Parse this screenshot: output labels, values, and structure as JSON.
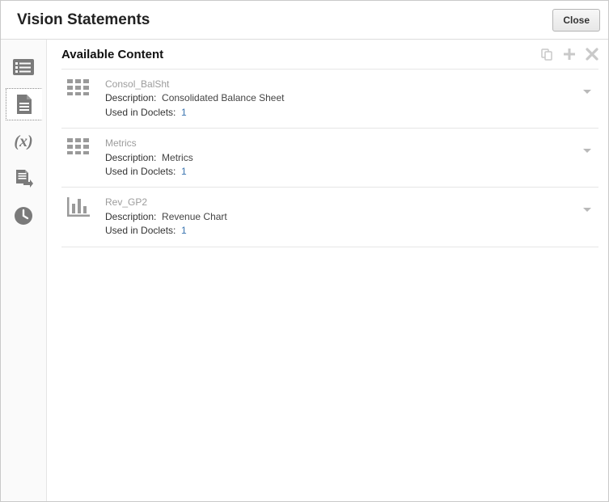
{
  "window": {
    "title": "Vision Statements",
    "close_label": "Close"
  },
  "main": {
    "heading": "Available Content",
    "labels": {
      "description": "Description:",
      "used_in_doclets": "Used in Doclets:"
    },
    "items": [
      {
        "name": "Consol_BalSht",
        "description": "Consolidated Balance Sheet",
        "used_count": "1",
        "icon": "grid"
      },
      {
        "name": "Metrics",
        "description": "Metrics",
        "used_count": "1",
        "icon": "grid"
      },
      {
        "name": "Rev_GP2",
        "description": "Revenue Chart",
        "used_count": "1",
        "icon": "chart"
      }
    ]
  }
}
